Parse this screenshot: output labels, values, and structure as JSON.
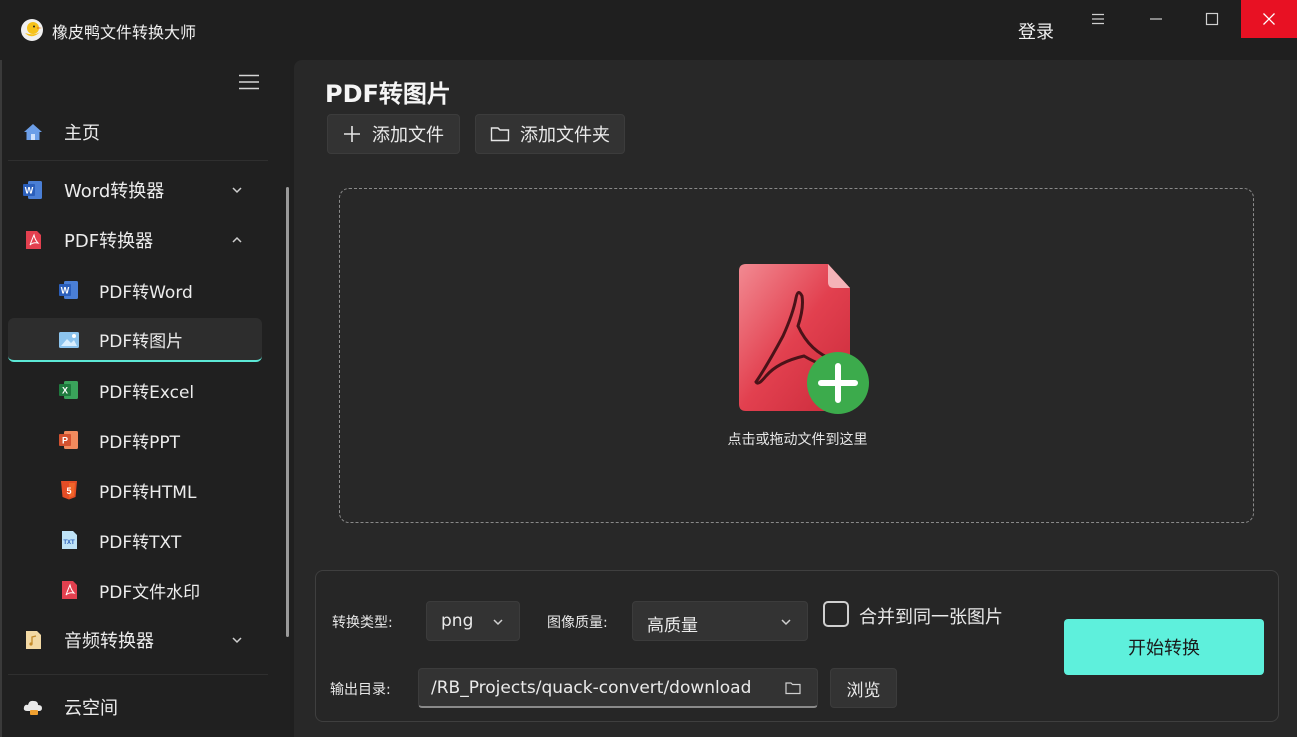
{
  "app": {
    "title": "橡皮鸭文件转换大师",
    "login": "登录"
  },
  "sidebar": {
    "home": "主页",
    "word_converter": "Word转换器",
    "pdf_converter": "PDF转换器",
    "pdf_items": [
      {
        "label": "PDF转Word",
        "icon": "word-icon"
      },
      {
        "label": "PDF转图片",
        "icon": "image-icon"
      },
      {
        "label": "PDF转Excel",
        "icon": "excel-icon"
      },
      {
        "label": "PDF转PPT",
        "icon": "ppt-icon"
      },
      {
        "label": "PDF转HTML",
        "icon": "html5-icon"
      },
      {
        "label": "PDF转TXT",
        "icon": "txt-icon"
      },
      {
        "label": "PDF文件水印",
        "icon": "pdf-icon"
      }
    ],
    "audio_converter": "音频转换器",
    "cloud": "云空间"
  },
  "main": {
    "title": "PDF转图片",
    "add_file": "添加文件",
    "add_folder": "添加文件夹",
    "drop_text": "点击或拖动文件到这里"
  },
  "options": {
    "type_label": "转换类型:",
    "type_value": "png",
    "quality_label": "图像质量:",
    "quality_value": "高质量",
    "merge_label": "合并到同一张图片",
    "output_label": "输出目录:",
    "output_value": "/RB_Projects/quack-convert/download",
    "browse": "浏览",
    "start": "开始转换"
  },
  "colors": {
    "accent": "#5ef0dc",
    "close": "#e81123",
    "pdf_red": "#e2404f",
    "add_green": "#3cab4c"
  }
}
